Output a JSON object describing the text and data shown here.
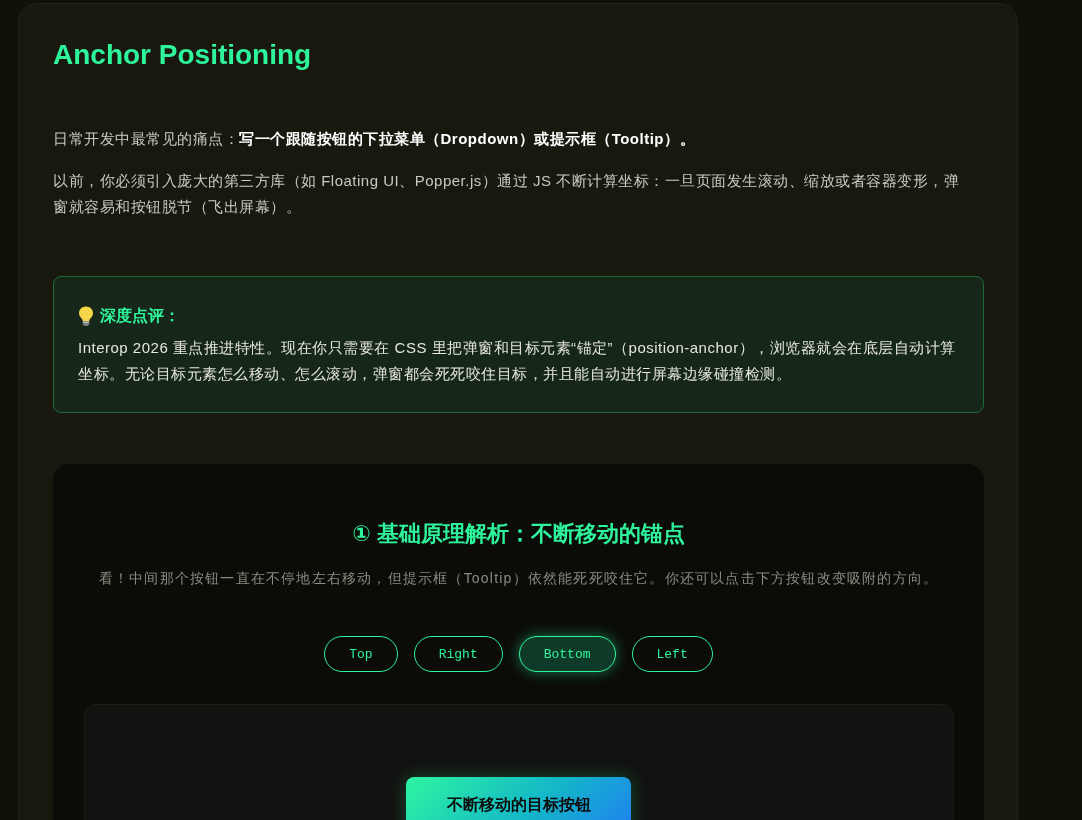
{
  "article": {
    "title": "Anchor Positioning",
    "paragraphs": [
      "日常开发中最常见的痛点：**写一个跟随按钮的下拉菜单（Dropdown）或提示框（Tooltip）。**",
      "以前，你必须引入庞大的第三方库（如 Floating UI、Popper.js）通过 JS 不断计算坐标：一旦页面发生滚动、缩放或者容器变形，弹窗就容易和按钮脱节（飞出屏幕）。"
    ],
    "callout": {
      "title": "深度点评：",
      "text": "Interop 2026 重点推进特性。现在你只需要在 CSS 里把弹窗和目标元素“锚定”（position-anchor），浏览器就会在底层自动计算坐标。无论目标元素怎么移动、怎么滚动，弹窗都会死死咬住目标，并且能自动进行屏幕边缘碰撞检测。"
    },
    "demo": {
      "title": "① 基础原理解析：不断移动的锚点",
      "description": "看！中间那个按钮一直在不停地左右移动，但提示框（Tooltip）依然能死死咬住它。你还可以点击下方按钮改变吸附的方向。",
      "placements": [
        {
          "label": "Top",
          "selected": false
        },
        {
          "label": "Right",
          "selected": false
        },
        {
          "label": "Bottom",
          "selected": true
        },
        {
          "label": "Left",
          "selected": false
        }
      ],
      "target_button": "不断移动的目标按钮"
    }
  }
}
